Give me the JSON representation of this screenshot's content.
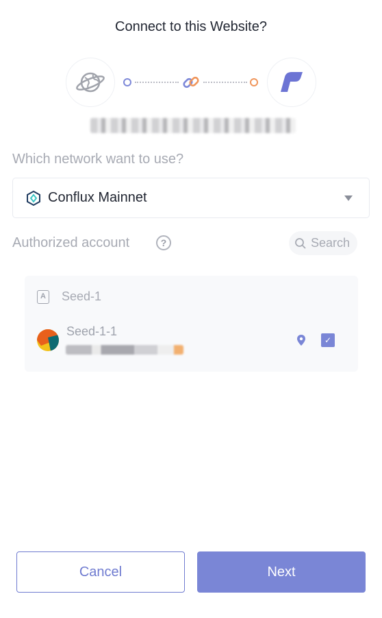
{
  "header": {
    "title": "Connect to this Website?"
  },
  "connection": {
    "site_icon": "globe-planet-icon",
    "link_icon": "chain-link-icon",
    "wallet_icon": "fluent-wallet-logo",
    "origin_text": ""
  },
  "network": {
    "label": "Which network want to use?",
    "selected": "Conflux Mainnet",
    "icon": "conflux-logo-icon"
  },
  "accounts": {
    "label": "Authorized account",
    "search_placeholder": "Search",
    "groups": [
      {
        "name": "Seed-1",
        "items": [
          {
            "name": "Seed-1-1",
            "address": "",
            "checked": true
          }
        ]
      }
    ]
  },
  "buttons": {
    "cancel": "Cancel",
    "next": "Next"
  },
  "colors": {
    "accent": "#7a86d6",
    "accent_dark": "#6f7bd0",
    "orange": "#f0955a",
    "muted_text": "#a7aab3"
  }
}
